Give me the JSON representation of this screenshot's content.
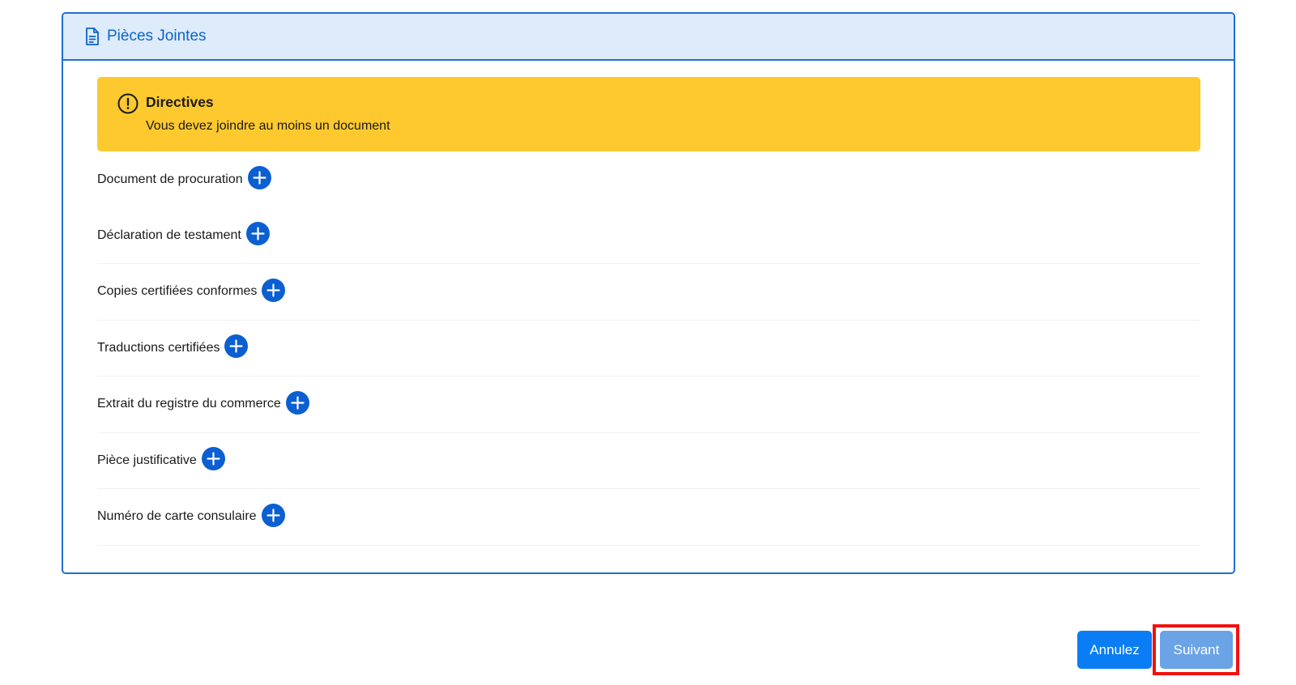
{
  "card": {
    "header_title": "Pièces Jointes",
    "header_icon": "document-icon",
    "accent_color": "#1f6fd1"
  },
  "alert": {
    "icon": "warning-icon",
    "title": "Directives",
    "text": "Vous devez joindre au moins un document",
    "bg_color": "#fec92f"
  },
  "attachments": [
    {
      "label": "Document de procuration",
      "action_icon": "plus-icon"
    },
    {
      "label": "Déclaration de testament",
      "action_icon": "plus-icon"
    },
    {
      "label": "Copies certifiées conformes",
      "action_icon": "plus-icon"
    },
    {
      "label": "Traductions certifiées",
      "action_icon": "plus-icon"
    },
    {
      "label": "Extrait du registre du commerce",
      "action_icon": "plus-icon"
    },
    {
      "label": "Pièce justificative",
      "action_icon": "plus-icon"
    },
    {
      "label": "Numéro de carte consulaire",
      "action_icon": "plus-icon"
    }
  ],
  "footer": {
    "cancel_label": "Annulez",
    "next_label": "Suivant",
    "highlight_color": "#f11010"
  }
}
